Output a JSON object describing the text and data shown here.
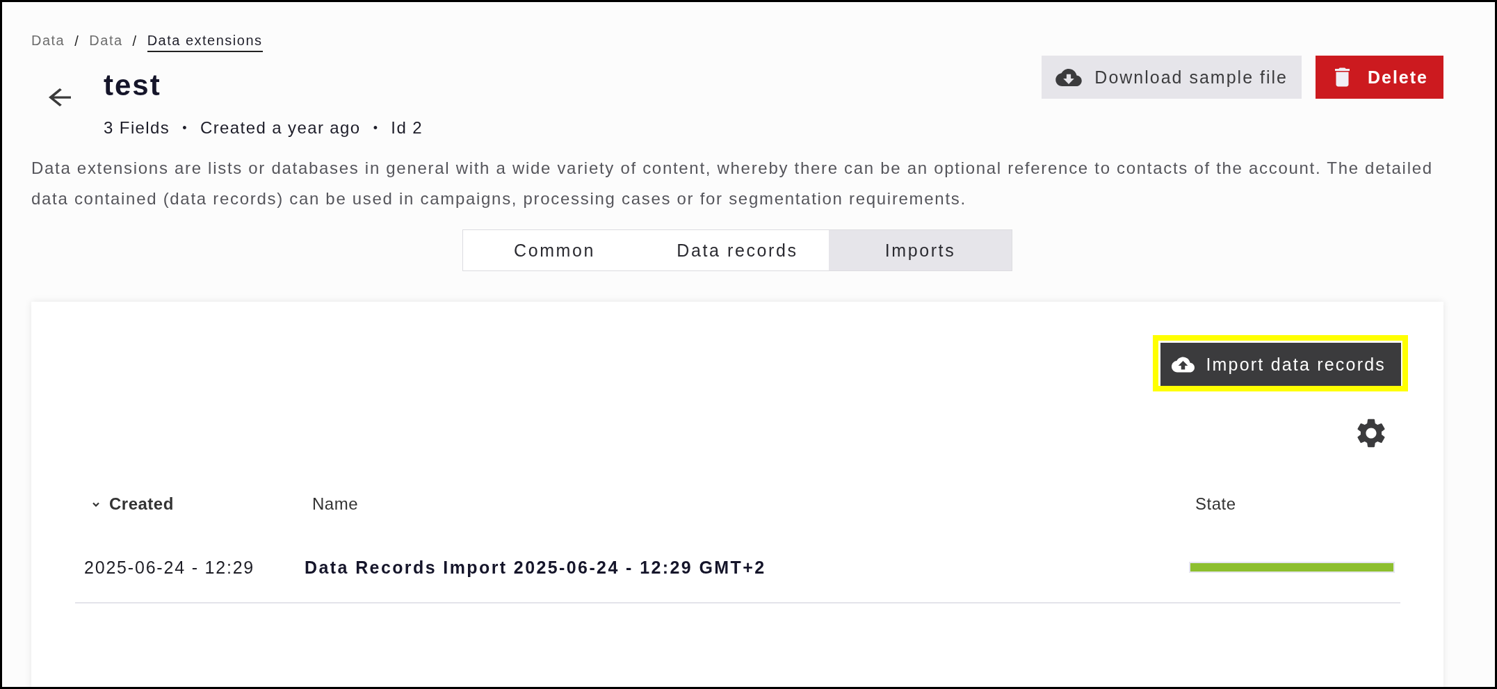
{
  "breadcrumb": [
    {
      "kind": "link",
      "label": "Data",
      "current": false
    },
    {
      "kind": "separator",
      "label": "/"
    },
    {
      "kind": "link",
      "label": "Data",
      "current": false
    },
    {
      "kind": "separator",
      "label": "/"
    },
    {
      "kind": "link",
      "label": "Data extensions",
      "current": true
    }
  ],
  "header": {
    "title": "test",
    "meta": [
      {
        "kind": "text",
        "label": "3 Fields"
      },
      {
        "kind": "separator",
        "label": "•"
      },
      {
        "kind": "text",
        "label": "Created a year ago"
      },
      {
        "kind": "separator",
        "label": "•"
      },
      {
        "kind": "text",
        "label": "Id 2"
      }
    ]
  },
  "actions": [
    {
      "kind": "download",
      "label": "Download sample file"
    },
    {
      "kind": "delete",
      "label": "Delete"
    }
  ],
  "description": "Data extensions are lists or databases in general with a wide variety of content, whereby there can be an optional reference to contacts of the account. The detailed data contained (data records) can be used in campaigns, processing cases or for segmentation requirements.",
  "tabs": [
    {
      "label": "Common",
      "selected": false
    },
    {
      "label": "Data records",
      "selected": false
    },
    {
      "label": "Imports",
      "selected": true
    }
  ],
  "panel": {
    "import_button": {
      "label": "Import data records",
      "highlighted": true
    },
    "table": {
      "columns": [
        {
          "label": "Created",
          "sorted": true
        },
        {
          "label": "Name",
          "sorted": false
        },
        {
          "label": "State",
          "sorted": false
        }
      ],
      "rows": [
        {
          "created": "2025-06-24 - 12:29",
          "name": "Data Records Import 2025-06-24 - 12:29 GMT+2",
          "level": 1
        }
      ]
    }
  }
}
